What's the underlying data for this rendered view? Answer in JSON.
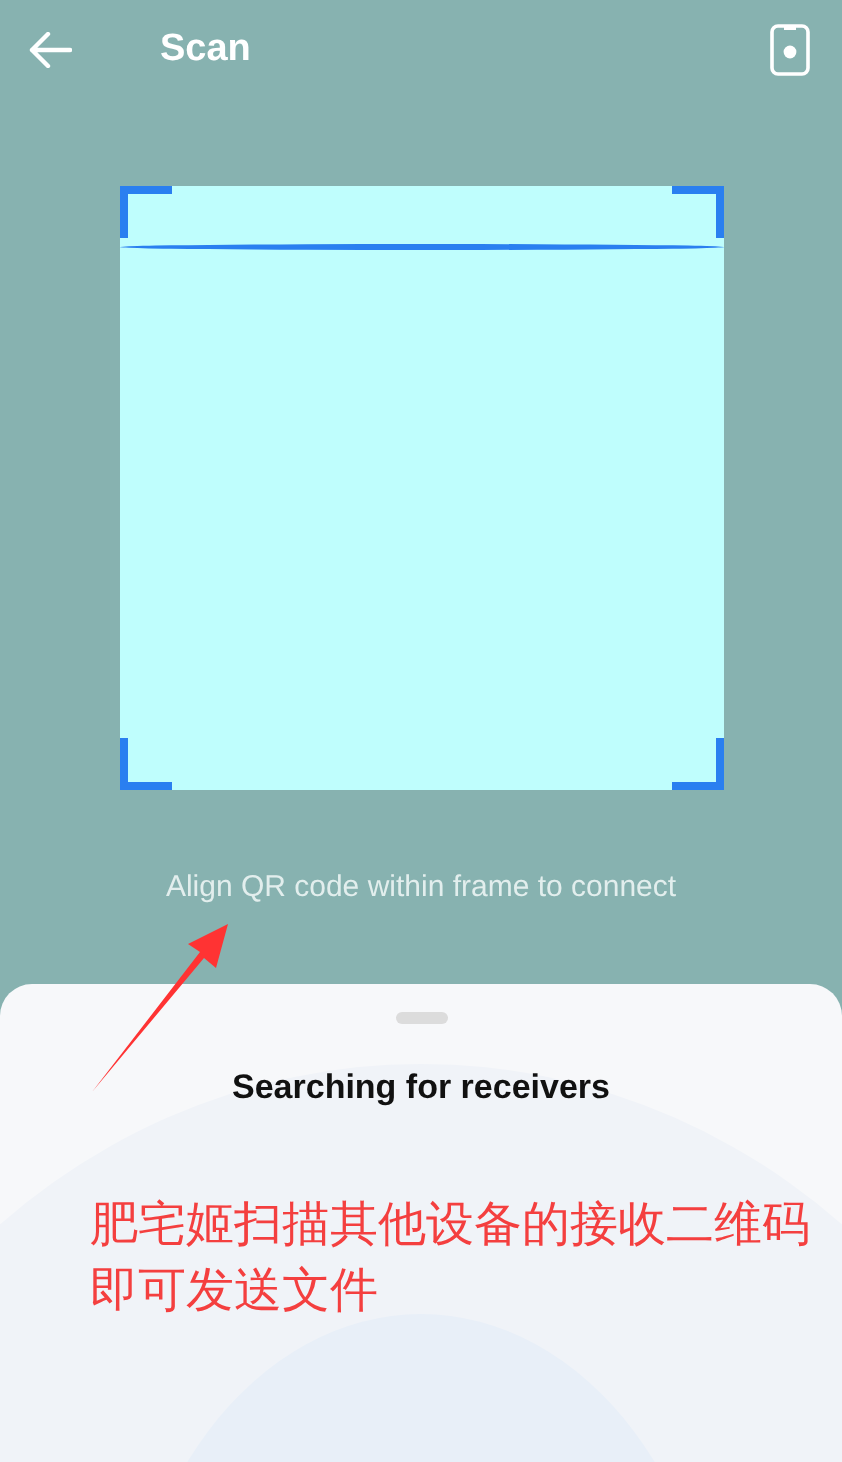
{
  "header": {
    "title": "Scan"
  },
  "hint": "Align QR code within frame to connect",
  "sheet": {
    "title": "Searching for receivers"
  },
  "annotation": {
    "text": "肥宅姬扫描其他设备的接收二维码即可发送文件"
  }
}
